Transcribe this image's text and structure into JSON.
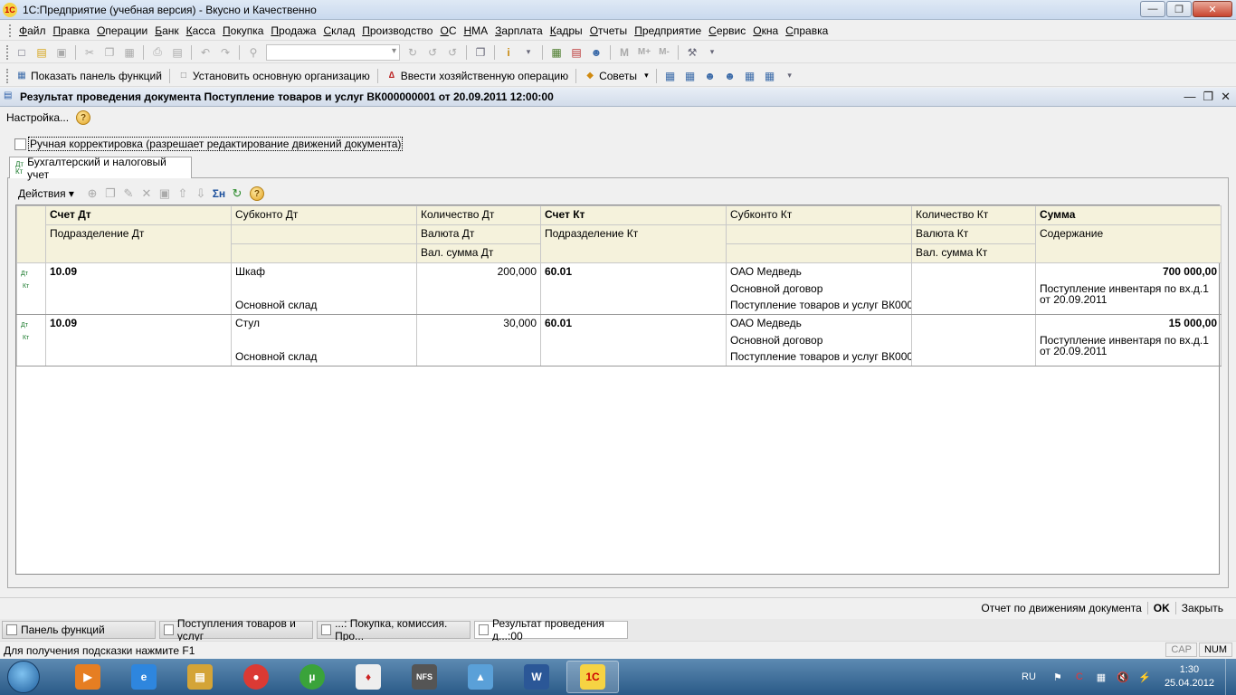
{
  "window": {
    "title": "1С:Предприятие (учебная версия) - Вкусно и Качественно"
  },
  "menu": [
    "Файл",
    "Правка",
    "Операции",
    "Банк",
    "Касса",
    "Покупка",
    "Продажа",
    "Склад",
    "Производство",
    "ОС",
    "НМА",
    "Зарплата",
    "Кадры",
    "Отчеты",
    "Предприятие",
    "Сервис",
    "Окна",
    "Справка"
  ],
  "toolbar2": {
    "show_panel": "Показать панель функций",
    "set_org": "Установить основную организацию",
    "enter_op": "Ввести хозяйственную операцию",
    "tips": "Советы"
  },
  "document": {
    "title": "Результат проведения документа Поступление товаров и услуг ВК000000001 от 20.09.2011 12:00:00",
    "settings": "Настройка...",
    "manual_correction": "Ручная корректировка (разрешает редактирование движений документа)",
    "tab": "Бухгалтерский и налоговый учет",
    "actions": "Действия"
  },
  "grid": {
    "headers": {
      "account_dt": "Счет Дт",
      "subconto_dt": "Субконто Дт",
      "qty_dt": "Количество Дт",
      "account_kt": "Счет Кт",
      "subconto_kt": "Субконто Кт",
      "qty_kt": "Количество Кт",
      "sum": "Сумма",
      "dept_dt": "Подразделение Дт",
      "currency_dt": "Валюта Дт",
      "dept_kt": "Подразделение Кт",
      "currency_kt": "Валюта Кт",
      "content": "Содержание",
      "cur_sum_dt": "Вал. сумма Дт",
      "cur_sum_kt": "Вал. сумма Кт"
    },
    "rows": [
      {
        "account_dt": "10.09",
        "subconto_dt_1": "Шкаф",
        "subconto_dt_3": "Основной склад",
        "qty_dt": "200,000",
        "account_kt": "60.01",
        "subconto_kt_1": "ОАО Медведь",
        "subconto_kt_2": "Основной договор",
        "subconto_kt_3": "Поступление товаров и услуг ВК000...",
        "sum": "700 000,00",
        "content": "Поступление инвентаря по вх.д.1 от 20.09.2011"
      },
      {
        "account_dt": "10.09",
        "subconto_dt_1": "Стул",
        "subconto_dt_3": "Основной склад",
        "qty_dt": "30,000",
        "account_kt": "60.01",
        "subconto_kt_1": "ОАО Медведь",
        "subconto_kt_2": "Основной договор",
        "subconto_kt_3": "Поступление товаров и услуг ВК000...",
        "sum": "15 000,00",
        "content": "Поступление инвентаря по вх.д.1 от 20.09.2011"
      }
    ]
  },
  "commands": {
    "report": "Отчет по движениям документа",
    "ok": "OK",
    "close": "Закрыть"
  },
  "window_tabs": [
    "Панель функций",
    "Поступления товаров и услуг",
    "...: Покупка, комиссия. Про...",
    "Результат проведения д...:00"
  ],
  "status": {
    "hint": "Для получения подсказки нажмите F1",
    "cap": "CAP",
    "num": "NUM"
  },
  "taskbar": {
    "lang": "RU",
    "time": "1:30",
    "date": "25.04.2012"
  }
}
